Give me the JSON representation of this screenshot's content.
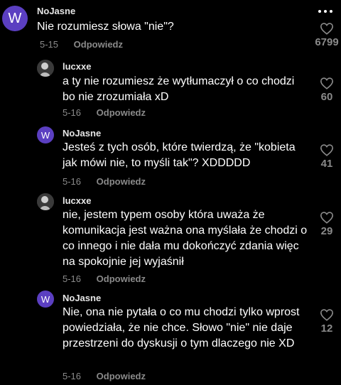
{
  "comments": [
    {
      "username": "NoJasne",
      "avatar_letter": "W",
      "text": "Nie rozumiesz słowa \"nie\"?",
      "date": "5-15",
      "reply_label": "Odpowiedz",
      "likes": "6799"
    },
    {
      "username": "lucxxe",
      "text": "a ty nie rozumiesz że wytłumaczył o co chodzi bo nie zrozumiała xD",
      "date": "5-16",
      "reply_label": "Odpowiedz",
      "likes": "60"
    },
    {
      "username": "NoJasne",
      "avatar_letter": "W",
      "text": "Jesteś z tych osób, które twierdzą, że \"kobieta jak mówi nie, to myśli tak\"? XDDDDD",
      "date": "5-16",
      "reply_label": "Odpowiedz",
      "likes": "41"
    },
    {
      "username": "lucxxe",
      "text": "nie, jestem typem osoby która uważa że komunikacja jest ważna ona myślała że chodzi o co innego i nie dała mu dokończyć zdania więc na spokojnie jej wyjaśnił",
      "date": "5-16",
      "reply_label": "Odpowiedz",
      "likes": "29"
    },
    {
      "username": "NoJasne",
      "avatar_letter": "W",
      "text": "Nie, ona nie pytała o co mu chodzi tylko wprost powiedziała, że nie chce. Słowo \"nie\" nie daje przestrzeni do dyskusji o tym dlaczego nie XD",
      "date": "5-16",
      "reply_label": "Odpowiedz",
      "likes": "12"
    }
  ],
  "colors": {
    "background": "#000000",
    "avatar_purple": "#5b3fc1",
    "meta_gray": "#8a8a8a"
  },
  "icons": [
    "more-icon",
    "heart-icon"
  ]
}
